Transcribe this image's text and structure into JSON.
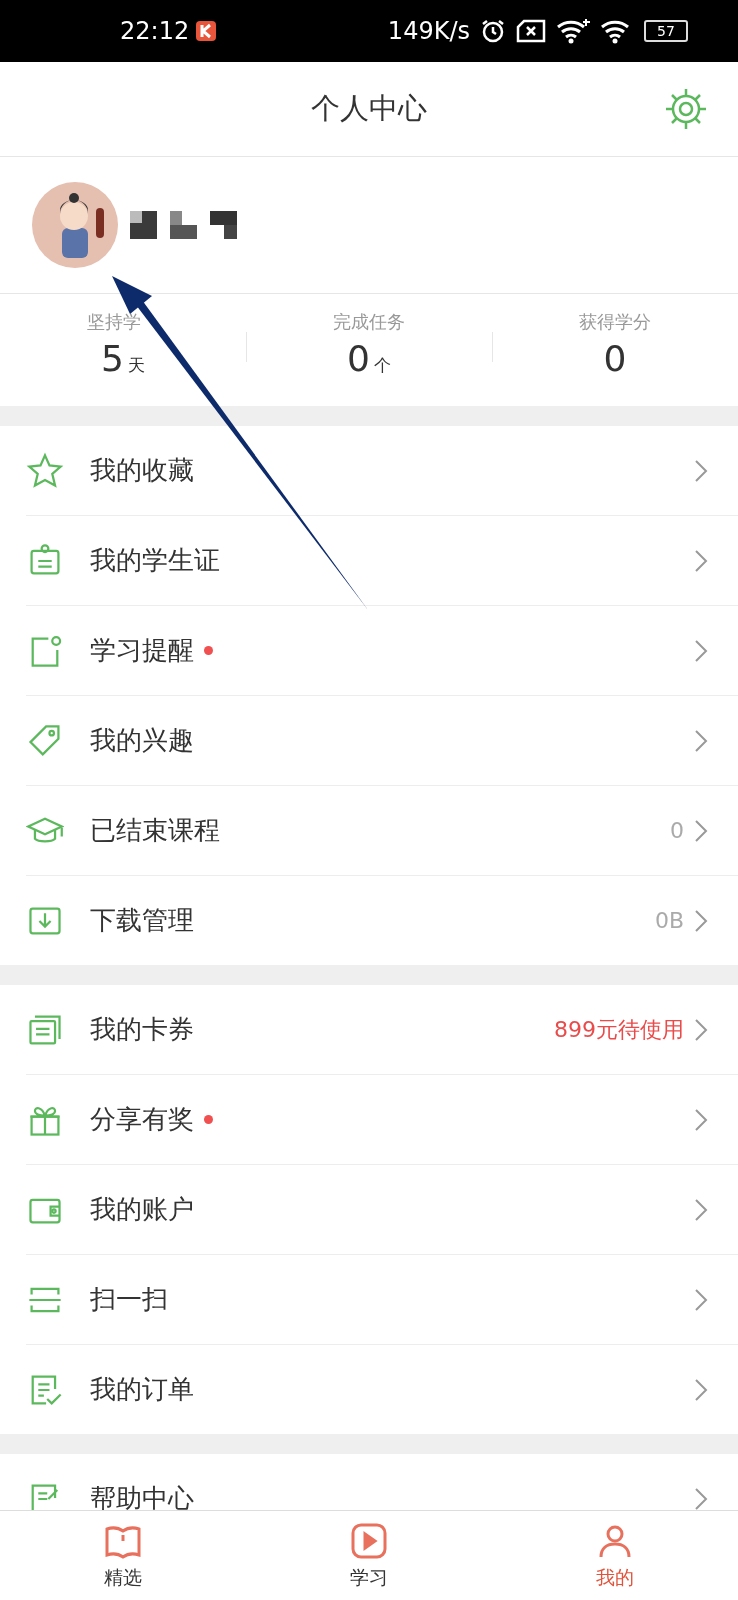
{
  "status_bar": {
    "time": "22:12",
    "speed": "149K/s",
    "battery": "57"
  },
  "header": {
    "title": "个人中心"
  },
  "profile": {
    "name_pixelated": true
  },
  "stats": [
    {
      "label": "坚持学",
      "value": "5",
      "unit": "天"
    },
    {
      "label": "完成任务",
      "value": "0",
      "unit": "个"
    },
    {
      "label": "获得学分",
      "value": "0"
    }
  ],
  "sections": [
    {
      "items": [
        {
          "label": "我的收藏",
          "dot": false
        },
        {
          "label": "我的学生证",
          "dot": false
        },
        {
          "label": "学习提醒",
          "dot": true
        },
        {
          "label": "我的兴趣",
          "dot": false
        },
        {
          "label": "已结束课程",
          "dot": false,
          "value": "0",
          "alert": false
        },
        {
          "label": "下载管理",
          "dot": false,
          "value": "0B",
          "alert": false
        }
      ]
    },
    {
      "items": [
        {
          "label": "我的卡券",
          "dot": false,
          "value": "899元待使用",
          "alert": true
        },
        {
          "label": "分享有奖",
          "dot": true
        },
        {
          "label": "我的账户",
          "dot": false
        },
        {
          "label": "扫一扫",
          "dot": false
        },
        {
          "label": "我的订单",
          "dot": false
        }
      ]
    },
    {
      "items": [
        {
          "label": "帮助中心",
          "dot": false
        }
      ]
    }
  ],
  "tabs": [
    {
      "label": "精选",
      "selected": false
    },
    {
      "label": "学习",
      "selected": false
    },
    {
      "label": "我的",
      "selected": true
    }
  ],
  "annotation_arrow": true
}
